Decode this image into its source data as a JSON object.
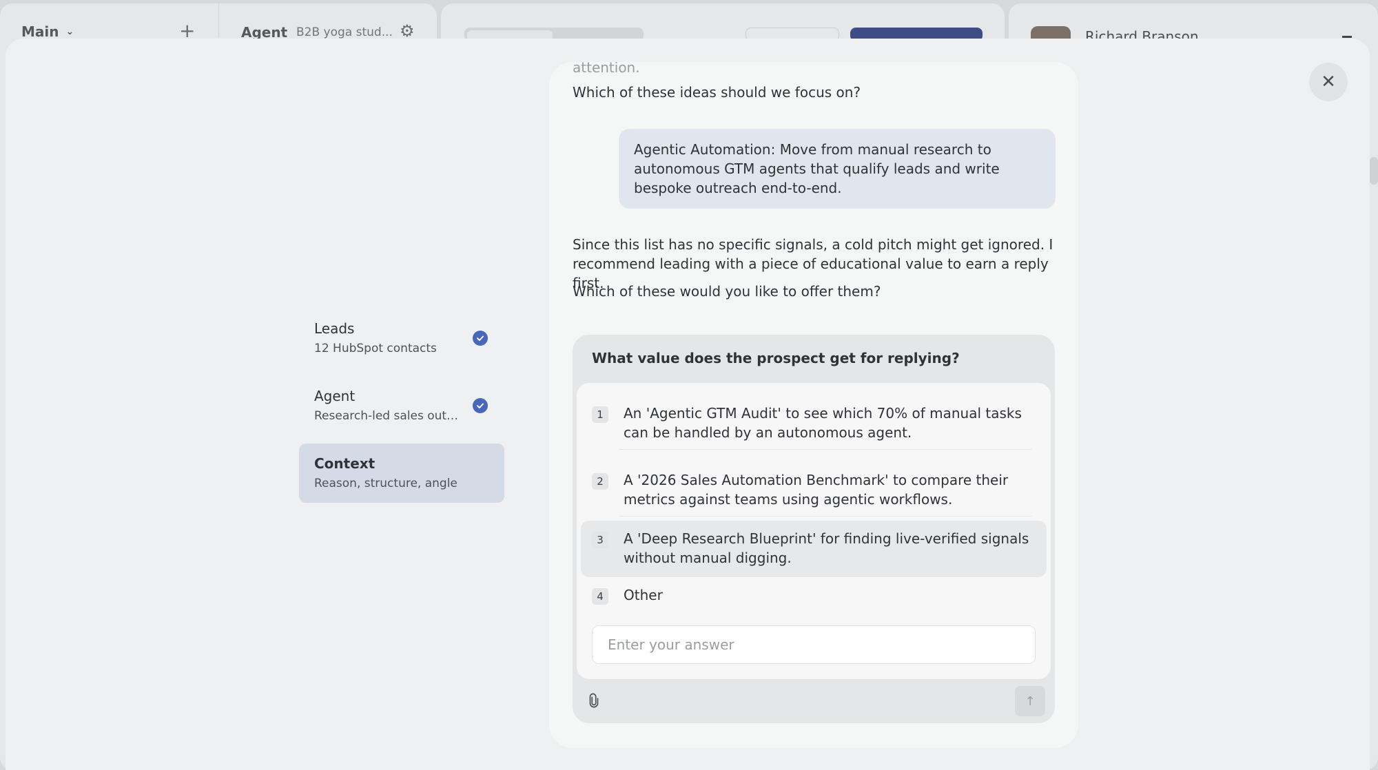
{
  "background": {
    "workspace": "Main",
    "agent_label": "Agent",
    "agent_desc": "B2B yoga stud...",
    "user_name": "Richard Branson"
  },
  "steps": [
    {
      "title": "Leads",
      "subtitle": "12 HubSpot contacts",
      "done": true
    },
    {
      "title": "Agent",
      "subtitle": "Research-led sales outre...",
      "done": true
    },
    {
      "title": "Context",
      "subtitle": "Reason, structure, angle",
      "done": false
    }
  ],
  "chat": {
    "faded_text": "attention.",
    "prompt_1": "Which of these ideas should we focus on?",
    "user_reply": "Agentic Automation: Move from manual research to autonomous GTM agents that qualify leads and write bespoke outreach end-to-end.",
    "agent_message": "Since this list has no specific signals, a cold pitch might get ignored. I recommend leading with a piece of educational value to earn a reply first.",
    "prompt_2": "Which of these would you like to offer them?"
  },
  "question": {
    "title": "What value does the prospect get for replying?",
    "options": [
      {
        "num": "1",
        "text": "An 'Agentic GTM Audit' to see which 70% of manual tasks can be handled by an autonomous agent."
      },
      {
        "num": "2",
        "text": "A '2026 Sales Automation Benchmark' to compare their metrics against teams using agentic workflows."
      },
      {
        "num": "3",
        "text": "A 'Deep Research Blueprint' for finding live-verified signals without manual digging."
      },
      {
        "num": "4",
        "text": "Other"
      }
    ],
    "input_placeholder": "Enter your answer"
  },
  "colors": {
    "accent": "#4767bd",
    "active_step": "#d4dbe7",
    "user_bubble": "#e1e6ee"
  }
}
